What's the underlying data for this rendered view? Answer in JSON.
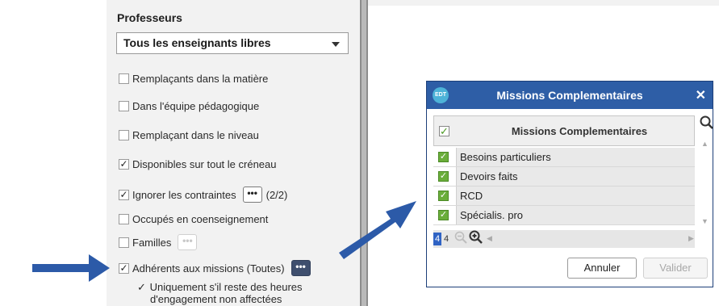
{
  "left": {
    "section_title": "Professeurs",
    "teacher_select": "Tous les enseignants libres",
    "options": [
      {
        "label": "Remplaçants dans la matière",
        "checked": false
      },
      {
        "label": "Dans l'équipe pédagogique",
        "checked": false
      },
      {
        "label": "Remplaçant dans le niveau",
        "checked": false
      },
      {
        "label": "Disponibles sur tout le créneau",
        "checked": true
      },
      {
        "label": "Ignorer les contraintes",
        "checked": true,
        "count": "(2/2)"
      },
      {
        "label": "Occupés en coenseignement",
        "checked": false
      },
      {
        "label": "Familles",
        "checked": false
      },
      {
        "label": "Adhérents aux missions (Toutes)",
        "checked": true
      }
    ],
    "sub_option": {
      "line1": "Uniquement s'il reste des heures",
      "line2": "d'engagement non affectées",
      "checked": true
    },
    "more_glyph": "•••"
  },
  "dialog": {
    "logo": "EDT",
    "title": "Missions Complementaires",
    "close": "✕",
    "column_header": "Missions Complementaires",
    "rows": [
      "Besoins particuliers",
      "Devoirs faits",
      "RCD",
      "Spécialis. pro"
    ],
    "page_active": "4",
    "page_total": "4",
    "cancel_label": "Annuler",
    "validate_label": "Valider"
  },
  "colors": {
    "dialog_title_bar": "#2e5ea6",
    "arrow": "#2c5aa8",
    "check_green": "#6aad3a",
    "mission_button": "#3f4f6e"
  },
  "icons": {
    "check": "✓",
    "search": "search-icon",
    "zoom_in": "zoom-in-icon",
    "zoom_out": "zoom-out-icon"
  }
}
